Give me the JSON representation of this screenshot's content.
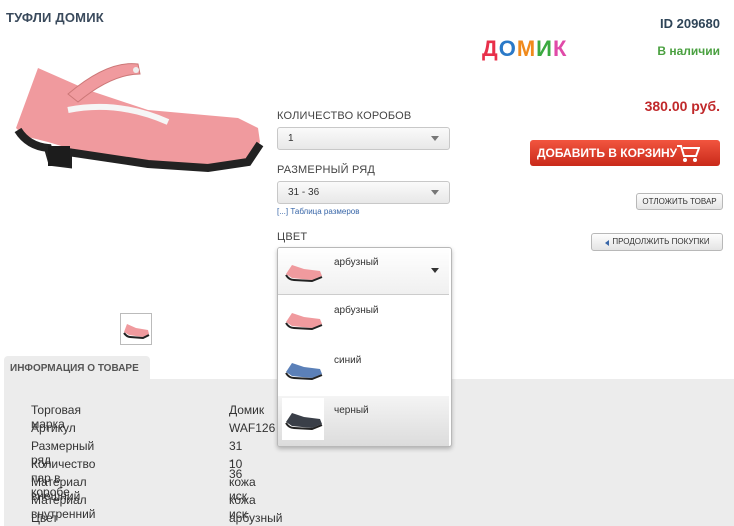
{
  "product": {
    "title": "ТУФЛИ ДОМИК",
    "id": "ID 209680",
    "brand_logo": [
      "Д",
      "О",
      "М",
      "И",
      "К"
    ],
    "brand_logo_colors": [
      "#e8304a",
      "#2a79c8",
      "#f08a1c",
      "#3aa940",
      "#e04aa8"
    ],
    "stock": "В наличии",
    "price": "380.00 руб.",
    "image_color": "#f09a9e"
  },
  "options": {
    "boxes_label": "КОЛИЧЕСТВО КОРОБОВ",
    "boxes_value": "1",
    "sizes_label": "РАЗМЕРНЫЙ РЯД",
    "sizes_value": "31 - 36",
    "size_table_link": "[...] Таблица размеров",
    "color_label": "ЦВЕТ",
    "color_selected": "арбузный",
    "color_options": [
      {
        "name": "арбузный",
        "color": "#f09a9e"
      },
      {
        "name": "синий",
        "color": "#5b80b8"
      },
      {
        "name": "черный",
        "color": "#3a3f48"
      }
    ]
  },
  "actions": {
    "add_to_cart": "ДОБАВИТЬ В КОРЗИНУ",
    "postpone": "ОТЛОЖИТЬ ТОВАР",
    "continue": "ПРОДОЛЖИТЬ ПОКУПКИ"
  },
  "info": {
    "tab_label": "ИНФОРМАЦИЯ О ТОВАРЕ",
    "rows": [
      {
        "key": "Торговая марка",
        "value": "Домик"
      },
      {
        "key": "Артикул",
        "value": "WAF126"
      },
      {
        "key": "Размерный ряд",
        "value": "31 - 36"
      },
      {
        "key": "Количество пар в коробе",
        "value": "10"
      },
      {
        "key": "Материал внешний",
        "value": "кожа иск"
      },
      {
        "key": "Материал внутренний",
        "value": "кожа иск"
      },
      {
        "key": "Цвет",
        "value": "арбузный"
      }
    ]
  }
}
